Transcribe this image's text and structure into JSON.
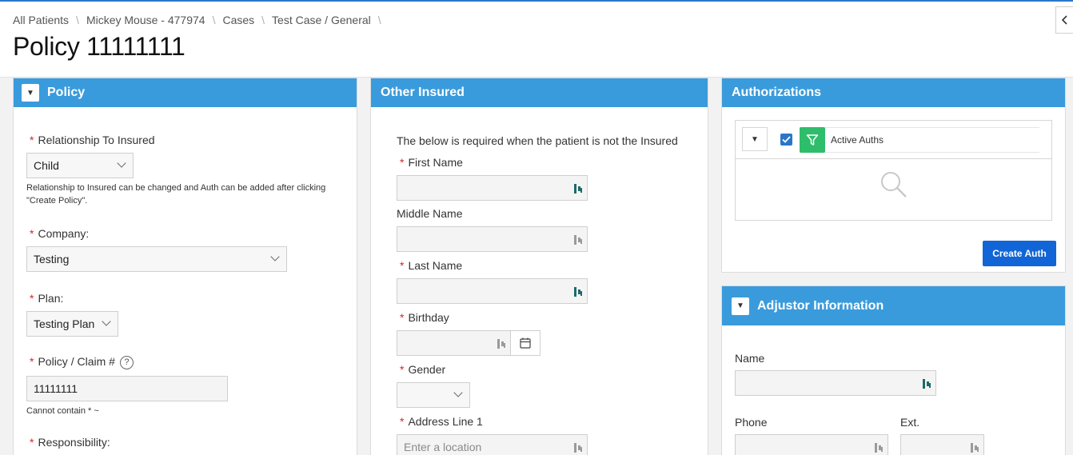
{
  "breadcrumb": [
    "All Patients",
    "Mickey Mouse - 477974",
    "Cases",
    "Test Case / General"
  ],
  "page_title": "Policy 11111111",
  "policy_panel": {
    "title": "Policy",
    "relationship_label": "Relationship To Insured",
    "relationship_value": "Child",
    "relationship_help": "Relationship to Insured can be changed and Auth can be added after clicking \"Create Policy\".",
    "company_label": "Company:",
    "company_value": "Testing",
    "plan_label": "Plan:",
    "plan_value": "Testing Plan",
    "policy_label": "Policy / Claim #",
    "help_glyph": "?",
    "policy_value": "11111111",
    "policy_help": "Cannot contain * ~",
    "responsibility_label": "Responsibility:"
  },
  "other_insured": {
    "title": "Other Insured",
    "note": "The below is required when the patient is not the Insured",
    "first_name_label": "First Name",
    "middle_name_label": "Middle Name",
    "last_name_label": "Last Name",
    "birthday_label": "Birthday",
    "gender_label": "Gender",
    "address1_label": "Address Line 1",
    "address1_placeholder": "Enter a location"
  },
  "authorizations": {
    "title": "Authorizations",
    "filter_label": "Active Auths",
    "create_button": "Create Auth"
  },
  "adjustor": {
    "title": "Adjustor Information",
    "name_label": "Name",
    "phone_label": "Phone",
    "ext_label": "Ext."
  },
  "colors": {
    "panel_header": "#3a9bdc",
    "primary_button": "#1165d6",
    "required": "#d7262c",
    "filter_chip": "#2ebd6b"
  },
  "icons": {
    "field_icon": "password-manager-icon",
    "calendar": "calendar-icon",
    "search": "search-icon",
    "filter": "filter-icon",
    "collapse": "chevron-left-icon",
    "toggle": "triangle-down-icon"
  }
}
